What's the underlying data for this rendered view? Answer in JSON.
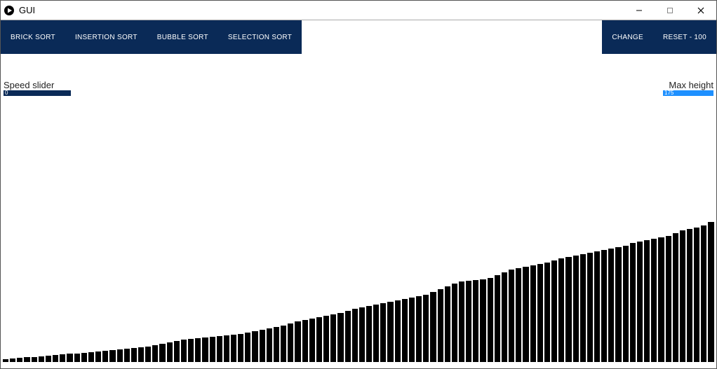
{
  "window": {
    "title": "GUI"
  },
  "toolbar": {
    "left": [
      {
        "id": "brick-sort",
        "label": "BRICK SORT"
      },
      {
        "id": "insertion-sort",
        "label": "INSERTION SORT"
      },
      {
        "id": "bubble-sort",
        "label": "BUBBLE SORT"
      },
      {
        "id": "selection-sort",
        "label": "SELECTION SORT"
      }
    ],
    "right": [
      {
        "id": "change",
        "label": "CHANGE"
      },
      {
        "id": "reset",
        "label": "RESET - 100"
      }
    ]
  },
  "sliders": {
    "speed": {
      "label": "Speed slider",
      "value": "0"
    },
    "max_height": {
      "label": "Max height",
      "value": "175"
    }
  },
  "chart_data": {
    "type": "bar",
    "title": "",
    "xlabel": "",
    "ylabel": "",
    "ylim": [
      0,
      200
    ],
    "values": [
      4,
      5,
      6,
      7,
      7,
      8,
      9,
      10,
      11,
      12,
      12,
      13,
      14,
      15,
      16,
      17,
      18,
      19,
      20,
      21,
      22,
      24,
      26,
      28,
      30,
      32,
      33,
      34,
      35,
      36,
      37,
      38,
      39,
      40,
      42,
      44,
      46,
      48,
      50,
      52,
      55,
      58,
      60,
      62,
      64,
      66,
      68,
      70,
      73,
      76,
      78,
      80,
      82,
      84,
      86,
      88,
      90,
      92,
      94,
      96,
      100,
      104,
      108,
      112,
      115,
      116,
      117,
      118,
      120,
      124,
      128,
      132,
      134,
      136,
      138,
      140,
      142,
      145,
      148,
      150,
      152,
      154,
      156,
      158,
      160,
      162,
      164,
      166,
      170,
      172,
      174,
      176,
      178,
      180,
      184,
      188,
      190,
      192,
      195,
      200
    ]
  },
  "colors": {
    "button_bg": "#0a2a57",
    "slider_blue": "#1e90ff",
    "bar": "#000000"
  }
}
